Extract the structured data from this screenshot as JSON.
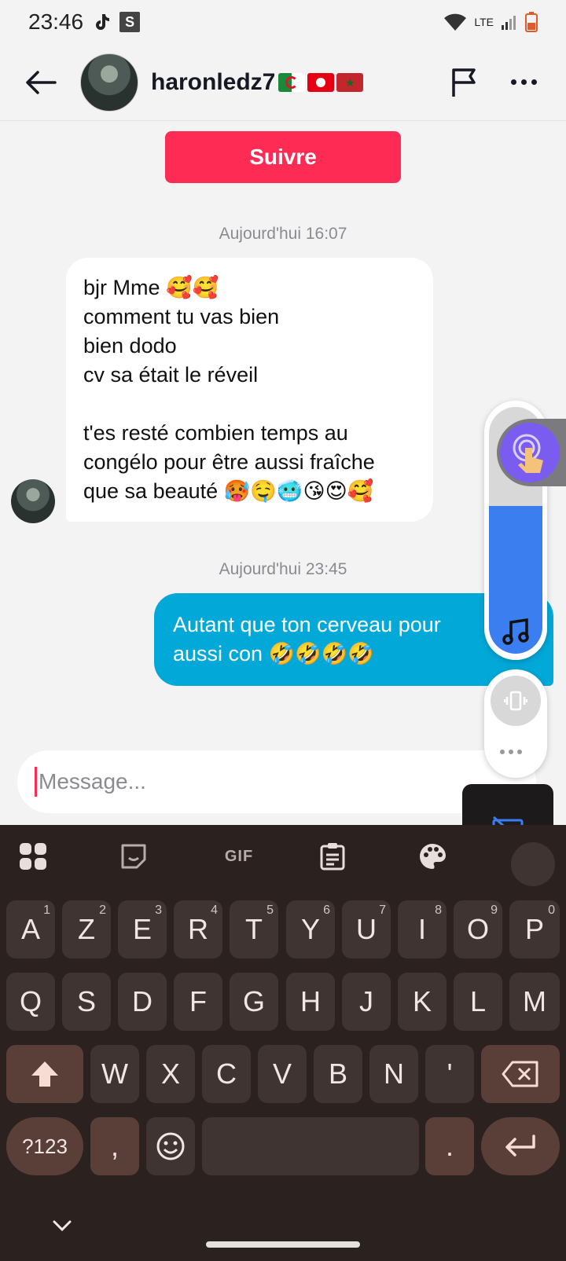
{
  "status_bar": {
    "time": "23:46",
    "network": "LTE"
  },
  "header": {
    "username": "haronledz7"
  },
  "follow_button": "Suivre",
  "messages": [
    {
      "timestamp": "Aujourd'hui 16:07",
      "text": "bjr Mme 🥰🥰\ncomment tu vas bien\nbien dodo\ncv sa était le réveil\n\nt'es resté combien temps au\ncongélo pour être aussi fraîche\nque sa beauté 🥵🤤🥶😘😍🥰"
    },
    {
      "timestamp": "Aujourd'hui 23:45",
      "text": "Autant que ton cerveau pour\naussi con 🤣🤣🤣🤣"
    }
  ],
  "composer": {
    "placeholder": "Message..."
  },
  "keyboard": {
    "toolbar_gif": "GIF",
    "row1": [
      {
        "key": "A",
        "hint": "1"
      },
      {
        "key": "Z",
        "hint": "2"
      },
      {
        "key": "E",
        "hint": "3"
      },
      {
        "key": "R",
        "hint": "4"
      },
      {
        "key": "T",
        "hint": "5"
      },
      {
        "key": "Y",
        "hint": "6"
      },
      {
        "key": "U",
        "hint": "7"
      },
      {
        "key": "I",
        "hint": "8"
      },
      {
        "key": "O",
        "hint": "9"
      },
      {
        "key": "P",
        "hint": "0"
      }
    ],
    "row2": [
      "Q",
      "S",
      "D",
      "F",
      "G",
      "H",
      "J",
      "K",
      "L",
      "M"
    ],
    "row3": [
      "W",
      "X",
      "C",
      "V",
      "B",
      "N",
      "'"
    ],
    "symbols_key": "?123",
    "comma_key": ",",
    "period_key": "."
  },
  "colors": {
    "accent": "#fe2c55",
    "outgoing_bubble": "#02a8d8",
    "keyboard_bg": "#2b2220"
  }
}
